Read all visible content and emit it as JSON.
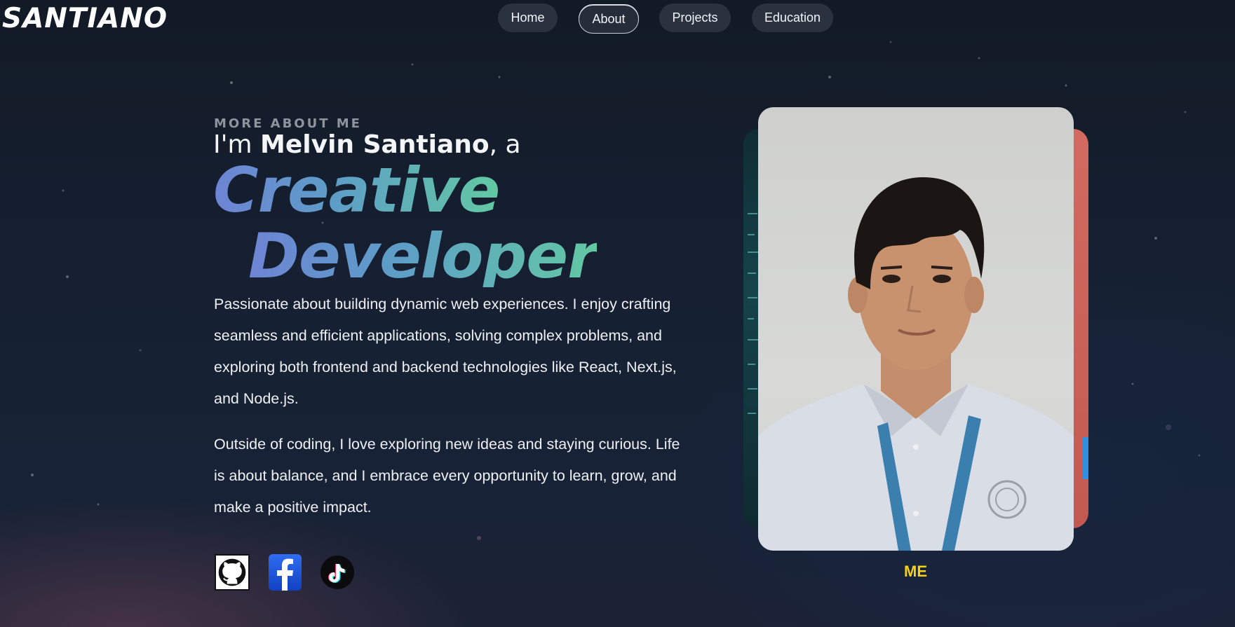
{
  "header": {
    "logo": "SANTIANO",
    "nav": [
      {
        "label": "Home"
      },
      {
        "label": "About",
        "active": true
      },
      {
        "label": "Projects"
      },
      {
        "label": "Education"
      }
    ]
  },
  "about": {
    "eyebrow": "MORE ABOUT ME",
    "intro_prefix": "I'm ",
    "name": "Melvin Santiano",
    "intro_suffix": ", a",
    "headline_1": "Creative",
    "headline_2": "Developer",
    "paragraph_1": "Passionate about building dynamic web experiences. I enjoy crafting seamless and efficient applications, solving complex problems, and exploring both frontend and backend technologies like React, Next.js, and Node.js.",
    "paragraph_2": "Outside of coding, I love exploring new ideas and staying curious. Life is about balance, and I embrace every opportunity to learn, grow, and make a positive impact."
  },
  "social": [
    {
      "icon": "github-icon"
    },
    {
      "icon": "facebook-icon"
    },
    {
      "icon": "tiktok-icon"
    }
  ],
  "photo": {
    "caption": "ME"
  },
  "colors": {
    "background": "#162032",
    "headline_gradient_start": "#6d84d4",
    "headline_gradient_end": "#62c9a3",
    "caption": "#f5d21a",
    "eyebrow": "#8e949c"
  }
}
